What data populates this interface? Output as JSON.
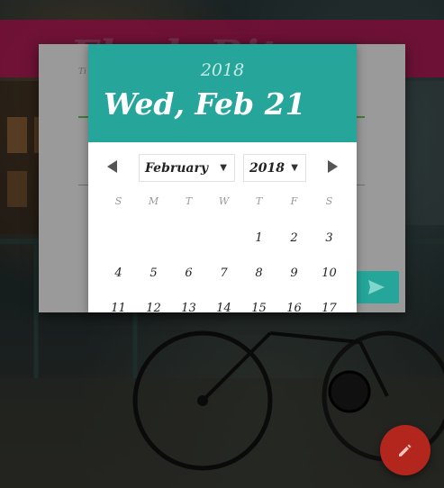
{
  "app": {
    "title": "Flash Bitacora"
  },
  "form": {
    "field_label": "Ti"
  },
  "picker": {
    "header_year": "2018",
    "header_date": "Wed, Feb 21",
    "month_select": "February",
    "year_select": "2018",
    "weekdays": [
      "S",
      "M",
      "T",
      "W",
      "T",
      "F",
      "S"
    ],
    "weeks": [
      [
        "",
        "",
        "",
        "",
        "1",
        "2",
        "3"
      ],
      [
        "4",
        "5",
        "6",
        "7",
        "8",
        "9",
        "10"
      ],
      [
        "11",
        "12",
        "13",
        "14",
        "15",
        "16",
        "17"
      ]
    ]
  },
  "icons": {
    "prev": "chevron-left-icon",
    "next": "chevron-right-icon",
    "send": "send-icon",
    "edit": "pencil-icon"
  },
  "colors": {
    "accent": "#26a69a",
    "banner": "#c2185b",
    "fab": "#b3261e"
  }
}
